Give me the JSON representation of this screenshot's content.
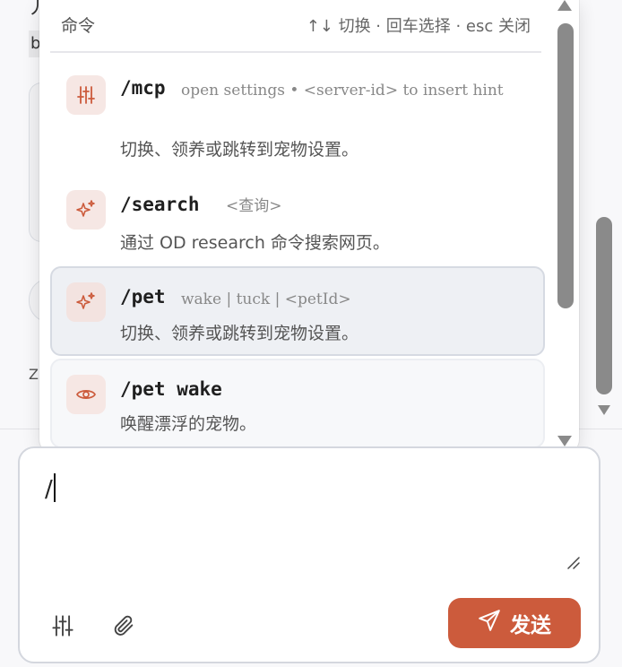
{
  "background": {
    "fragment_top": "丿",
    "fragment_b": "b",
    "fragment_z": "Z"
  },
  "palette": {
    "title": "命令",
    "hint": "↑↓ 切换 · 回车选择 · esc 关闭",
    "items": [
      {
        "command": "/mcp",
        "args": "open settings • <server-id> to insert hint",
        "description": "切换、领养或跳转到宠物设置。",
        "icon": "sliders-icon",
        "selected": false
      },
      {
        "command": "/search",
        "args": "<查询>",
        "description": "通过 OD research 命令搜索网页。",
        "icon": "sparkle-icon",
        "selected": false
      },
      {
        "command": "/pet",
        "args": "wake | tuck | <petId>",
        "description": "切换、领养或跳转到宠物设置。",
        "icon": "sparkle-icon",
        "selected": true
      },
      {
        "command": "/pet wake",
        "args": "",
        "description": "唤醒漂浮的宠物。",
        "icon": "eye-icon",
        "selected": false
      }
    ]
  },
  "composer": {
    "value": "/",
    "send_label": "发送",
    "tools": [
      "sliders-icon",
      "paperclip-icon"
    ]
  },
  "colors": {
    "accent": "#cc5b3c",
    "icon_bg": "#f6e7e4",
    "selected_bg": "#eef0f4"
  }
}
